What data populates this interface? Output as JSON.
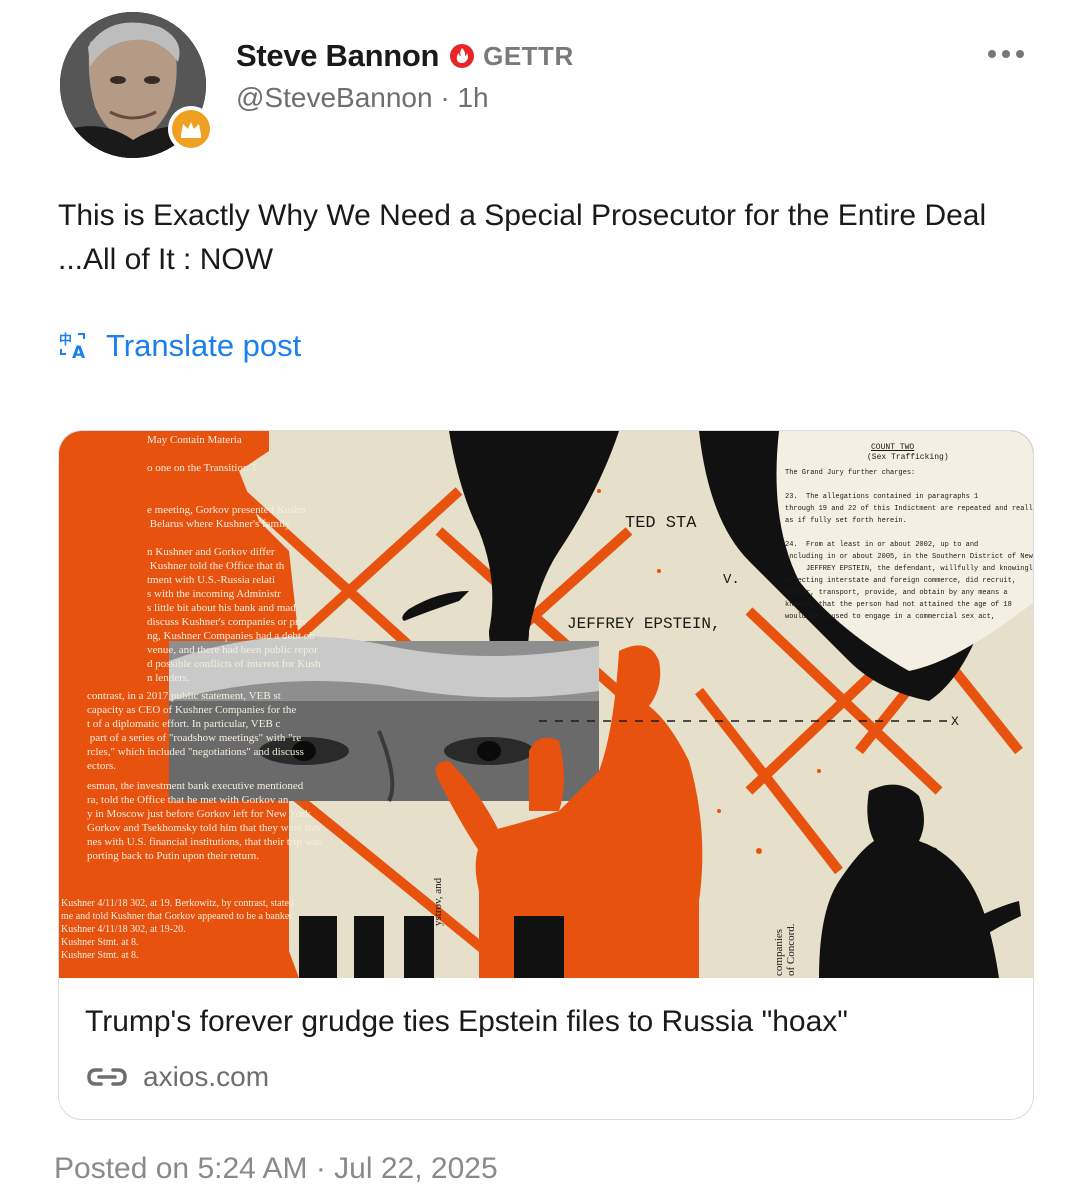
{
  "author": {
    "name": "Steve Bannon",
    "platform": "GETTR",
    "handle": "@SteveBannon",
    "time_ago": "1h",
    "avatar_icon": "profile-photo",
    "badge_icon": "crown-icon",
    "verified_icon": "verified-flame-icon"
  },
  "post": {
    "text": "This is Exactly Why We Need a Special Prosecutor for the Entire Deal ...All of It : NOW",
    "translate_label": "Translate post"
  },
  "link_card": {
    "title": "Trump's forever grudge ties Epstein files to Russia \"hoax\"",
    "domain": "axios.com",
    "image_text": {
      "document_left": "May Contain Materia\n\no one on the Transition T\n\n\ne meeting, Gorkov presented Kushn\n Belarus where Kushner's family\n\nn Kushner and Gorkov differ\n Kushner told the Office that th\ntment with U.S.-Russia relati\ns with the incoming Administr\ns little bit about his bank and mad\ndiscuss Kushner's companies or priv\nng, Kushner Companies had a debt ob\nvenue, and there had been public repor\nd possible conflicts of interest for Kush\nn lenders.",
      "document_left_2": "contrast, in a 2017 public statement, VEB st\ncapacity as CEO of Kushner Companies for the\nt of a diplomatic effort. In particular, VEB c\n part of a series of \"roadshow meetings\" with \"re\nrcles,\" which included \"negotiations\" and discuss\nectors.",
      "document_left_3": "esman, the investment bank executive mentioned\nra, told the Office that he met with Gorkov an\ny in Moscow just before Gorkov left for New York\nGorkov and Tsekhomsky told him that they were trav\nnes with U.S. financial institutions, that their trip was\nporting back to Putin upon their return.",
      "footnotes": "Kushner 4/11/18 302, at 19. Berkowitz, by contrast, stated\nme and told Kushner that Gorkov appeared to be a banker.\nKushner 4/11/18 302, at 19-20.\nKushner Stmt. at 8.\nKushner Stmt. at 8.",
      "united_states": "TED STA",
      "v_label": "V.",
      "epstein": "JEFFREY EPSTEIN,",
      "count_two": "COUNT TWO",
      "sex_trafficking": "(Sex Trafficking)",
      "indictment": "The Grand Jury further charges:\n\n23.  The allegations contained in paragraphs 1\nthrough 19 and 22 of this Indictment are repeated and realleged\nas if fully set forth herein.\n\n24.  From at least in or about 2002, up to and\nincluding in or about 2005, in the Southern District of New\n     JEFFREY EPSTEIN, the defendant, willfully and knowingly,\naffecting interstate and foreign commerce, did recruit,\nharbor, transport, provide, and obtain by any means a\nknowing that the person had not attained the age of 18\nwould be caused to engage in a commercial sex act,",
      "x_mark": "X",
      "side_text_1": "ystrov, and",
      "side_text_2": "companies\nof Concord."
    }
  },
  "footer": {
    "posted": "Posted on 5:24 AM · Jul 22, 2025"
  },
  "colors": {
    "accent_blue": "#1a7ff0",
    "orange": "#e8520f",
    "verified_red": "#e8262a",
    "badge_gold": "#f0a020"
  }
}
